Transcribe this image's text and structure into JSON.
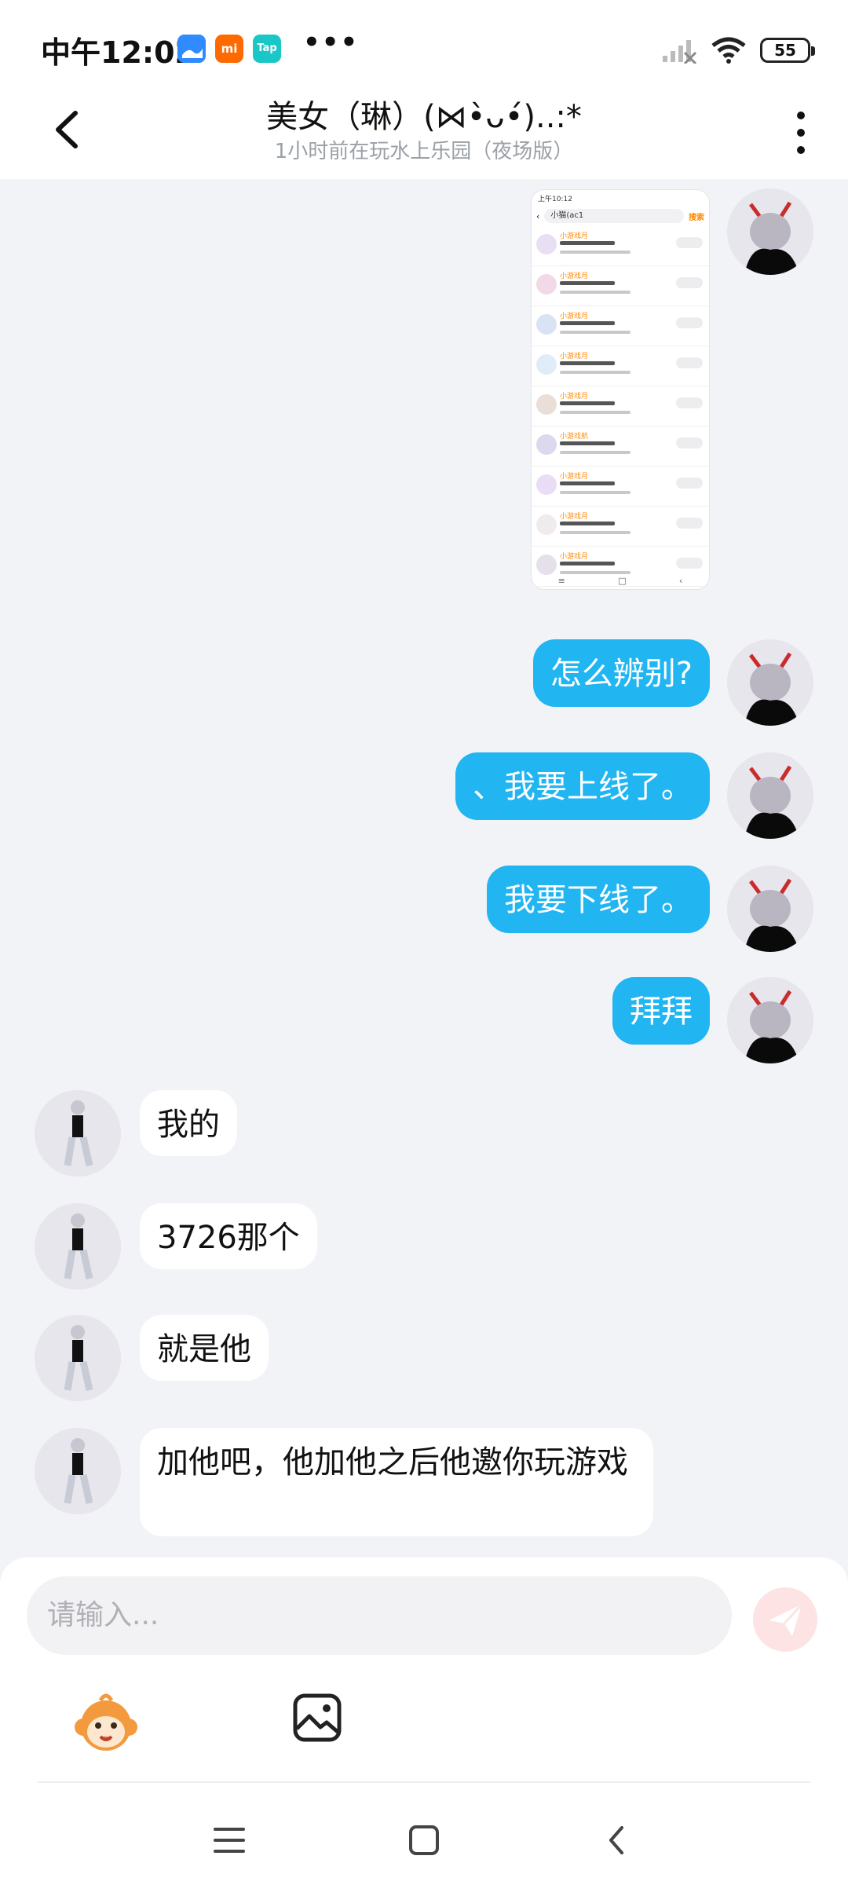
{
  "status_bar": {
    "time": "中午12:02",
    "app_icons": [
      {
        "name": "gallery-icon",
        "color": "#2f8bff"
      },
      {
        "name": "mi-store-icon",
        "label": "mi",
        "color": "#ff6a00"
      },
      {
        "name": "taptap-icon",
        "label": "Tap",
        "color": "#19c7c7"
      }
    ],
    "overflow": "•••",
    "battery": "55"
  },
  "header": {
    "title": "美女（琳）(⋈•̀ᴗ•́)..:*",
    "subtitle": "1小时前在玩水上乐园（夜场版）"
  },
  "messages": [
    {
      "direction": "out",
      "type": "image",
      "text": ""
    },
    {
      "direction": "out",
      "type": "text",
      "text": "怎么辨别?"
    },
    {
      "direction": "out",
      "type": "text",
      "text": "、我要上线了。"
    },
    {
      "direction": "out",
      "type": "text",
      "text": "我要下线了。"
    },
    {
      "direction": "out",
      "type": "text",
      "text": "拜拜"
    },
    {
      "direction": "in",
      "type": "text",
      "text": "我的"
    },
    {
      "direction": "in",
      "type": "text",
      "text": "3726那个"
    },
    {
      "direction": "in",
      "type": "text",
      "text": "就是他"
    },
    {
      "direction": "in",
      "type": "text",
      "text": "加他吧，他加他之后他邀你玩游戏"
    }
  ],
  "shared_screenshot": {
    "status_time": "上午10:12",
    "search_text": "小猫(ac1",
    "search_button": "搜索",
    "rows": [
      {
        "name": "小游戏月"
      },
      {
        "name": "小游戏月"
      },
      {
        "name": "小游戏月"
      },
      {
        "name": "小游戏月"
      },
      {
        "name": "小游戏月"
      },
      {
        "name": "小游戏航"
      },
      {
        "name": "小游戏月"
      },
      {
        "name": "小游戏月"
      },
      {
        "name": "小游戏月"
      }
    ]
  },
  "composer": {
    "placeholder": "请输入..."
  },
  "colors": {
    "outgoing_bubble": "#21b5f2",
    "incoming_bubble": "#ffffff",
    "chat_background": "#f2f3f7",
    "send_button": "#fde3e3"
  }
}
